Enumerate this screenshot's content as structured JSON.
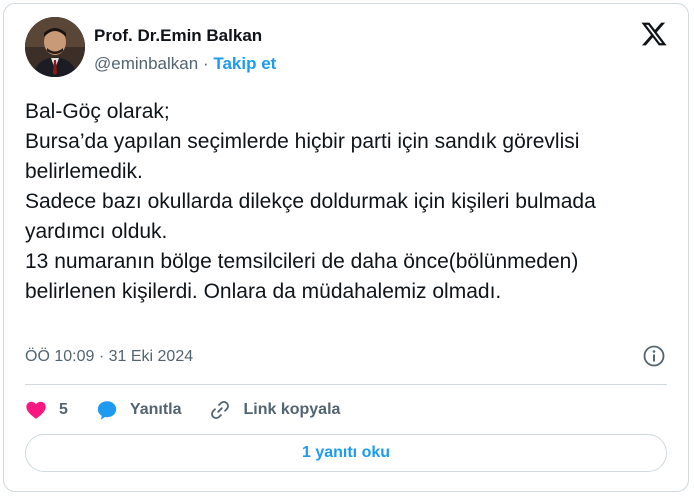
{
  "author": {
    "name": "Prof. Dr.Emin Balkan",
    "handle": "@eminbalkan",
    "separator": "·",
    "follow_label": "Takip et"
  },
  "tweet": {
    "text": "Bal-Göç olarak;\nBursa’da yapılan seçimlerde hiçbir parti için sandık görevlisi belirlemedik.\nSadece bazı okullarda dilekçe doldurmak için kişileri bulmada yardımcı olduk.\n13 numaranın bölge temsilcileri de daha önce(bölünmeden) belirlenen kişilerdi. Onlara da müdahalemiz olmadı.",
    "time": "ÖÖ 10:09",
    "separator": "·",
    "date": "31 Eki 2024"
  },
  "actions": {
    "like_count": "5",
    "reply_label": "Yanıtla",
    "copy_link_label": "Link kopyala"
  },
  "read_replies_label": "1 yanıtı oku",
  "icons": {
    "like": "heart-icon",
    "reply": "speech-bubble-icon",
    "copy_link": "link-icon",
    "info": "info-icon",
    "brand": "x-logo-icon"
  },
  "colors": {
    "accent": "#1d9bf0",
    "like": "#f91880",
    "text": "#0f1419",
    "secondary": "#536471",
    "border": "#cfd9de"
  }
}
